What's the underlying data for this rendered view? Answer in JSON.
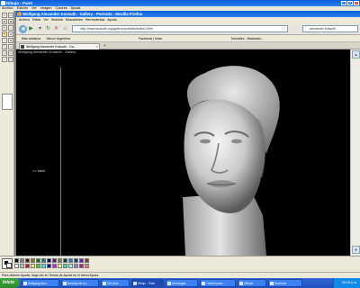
{
  "paint": {
    "title": "Dibujo - Paint",
    "menu": [
      "Archivo",
      "Edición",
      "Ver",
      "Imagen",
      "Colores",
      "Ayuda"
    ],
    "status": "Para obtener Ayuda, haga clic en Temas de Ayuda en el menú Ayuda.",
    "palette": [
      "#000000",
      "#808080",
      "#800000",
      "#808000",
      "#008000",
      "#008080",
      "#000080",
      "#800080",
      "#808040",
      "#004040",
      "#0080ff",
      "#004080",
      "#8000ff",
      "#804000",
      "#ffffff",
      "#c0c0c0",
      "#ff0000",
      "#ffff00",
      "#00ff00",
      "#00ffff",
      "#0000ff",
      "#ff00ff",
      "#ffff80",
      "#00ff80",
      "#80ffff",
      "#8080ff",
      "#ff0080",
      "#ff8040"
    ]
  },
  "firefox": {
    "title": "Wolfgang Alexander Kossuth - Gallery - Portraits - Mozilla Firefox",
    "menu": [
      "Archivo",
      "Editar",
      "Ver",
      "Historial",
      "Marcadores",
      "Herramientas",
      "Ayuda"
    ],
    "url": "http://www.kossuth.org/gallery/portraits/index1.html",
    "search": "alexander kossuth",
    "bookmarks": [
      "Más visitados",
      "Yahoo! Argentina",
      "Facebook | Inicio",
      "Tutoriales - Modelado..."
    ],
    "tab_label": "Wolfgang Alexander Kossuth - Ga...",
    "page_title": "Wolfgang Alexander Kossuth - Gallery",
    "back_link": "<< back"
  },
  "taskbar": {
    "start": "Inicio",
    "tasks": [
      "Wolfgang Alex...",
      "Bandeja de en...",
      "3Ds Max",
      "Dibujo - Paint",
      "Descargas",
      "Tutorial paso...",
      "ZBrush",
      "Escritorio"
    ],
    "clock": "06:15 p.m."
  }
}
